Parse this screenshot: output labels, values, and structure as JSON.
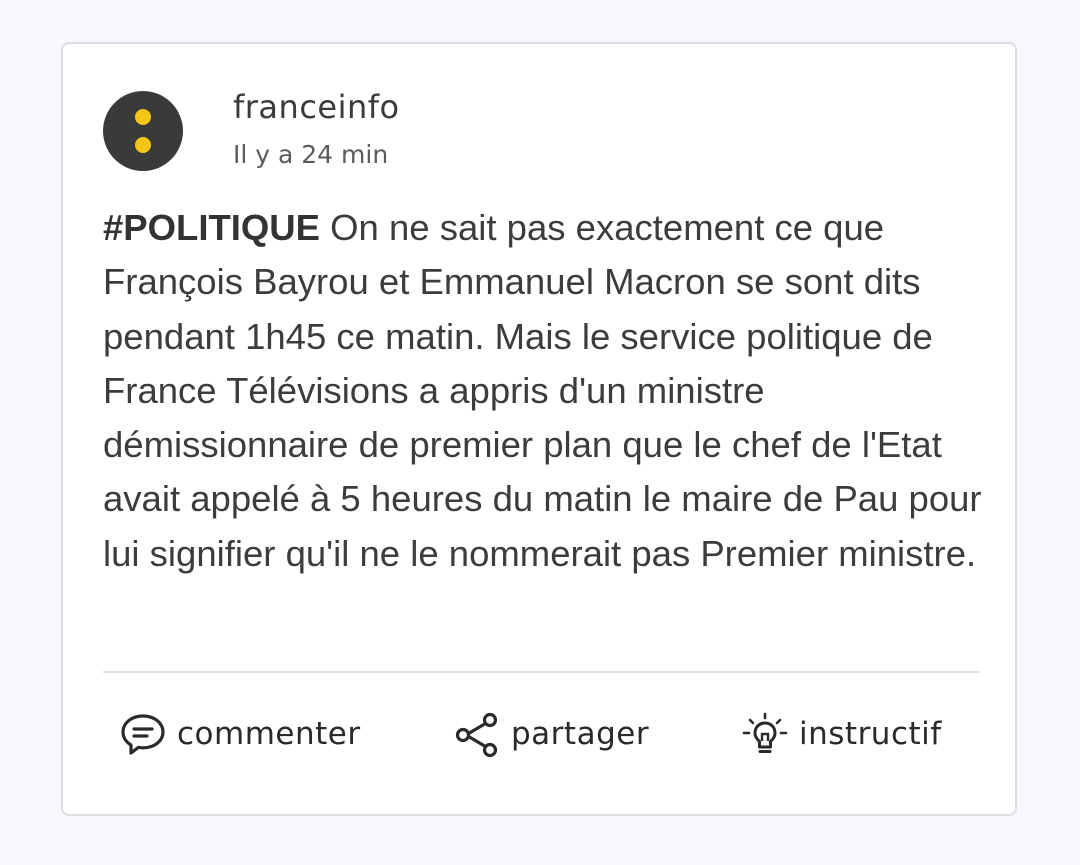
{
  "post": {
    "source": "franceinfo",
    "time_ago": "Il y a 24 min",
    "hashtag": "#POLITIQUE",
    "text": " On ne sait pas exactement ce que François Bayrou et Emmanuel Macron se sont dits pendant 1h45 ce matin. Mais le service politique de France Télévisions a appris d'un ministre démissionnaire de premier plan que le chef de l'Etat avait appelé à 5 heures du matin le maire de Pau pour lui signifier qu'il ne le nommerait pas Premier ministre."
  },
  "actions": {
    "comment_label": "commenter",
    "share_label": "partager",
    "insight_label": "instructif"
  },
  "icons": {
    "avatar": "franceinfo-logo",
    "comment": "comment-bubble-icon",
    "share": "share-icon",
    "insight": "lightbulb-icon"
  },
  "colors": {
    "logo_bg": "#3a3a3a",
    "logo_dots": "#f5c518",
    "text": "#3c3c3c"
  }
}
